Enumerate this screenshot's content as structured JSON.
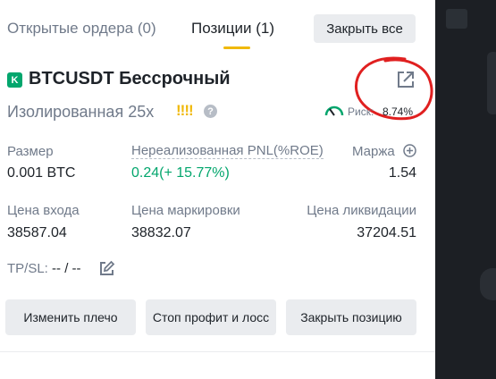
{
  "tabs": {
    "open_orders": "Открытые ордера (0)",
    "positions": "Позиции (1)",
    "close_all": "Закрыть все"
  },
  "position": {
    "badge": "K",
    "title": "BTCUSDT Бессрочный",
    "margin_mode": "Изолированная 25x",
    "warning": "!!!!",
    "help": "?",
    "risk_label": "Риск:",
    "risk_value": "8.74%",
    "size_label": "Размер",
    "size_value": "0.001 BTC",
    "pnl_label": "Нереализованная PNL(%ROE)",
    "pnl_value": "0.24(+ 15.77%)",
    "margin_label": "Маржа",
    "margin_value": "1.54",
    "entry_label": "Цена входа",
    "entry_value": "38587.04",
    "mark_label": "Цена маркировки",
    "mark_value": "38832.07",
    "liq_label": "Цена ликвидации",
    "liq_value": "37204.51",
    "tpsl_label": "TP/SL:",
    "tpsl_value": "-- / --"
  },
  "actions": {
    "leverage": "Изменить плечо",
    "stop": "Стоп профит и лосс",
    "close": "Закрыть позицию"
  },
  "colors": {
    "accent": "#f0b90b",
    "positive": "#03a66d",
    "annotation": "#e02020"
  },
  "icons": [
    "share-icon",
    "help-icon",
    "risk-gauge-icon",
    "add-margin-icon",
    "edit-icon"
  ]
}
